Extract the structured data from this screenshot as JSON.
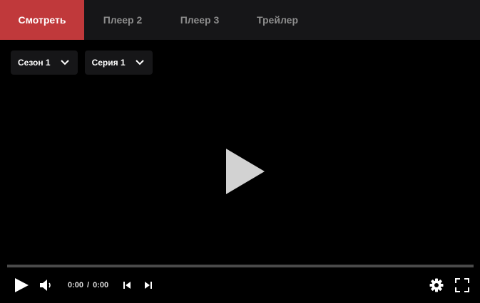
{
  "tabs": [
    {
      "label": "Смотреть",
      "active": true
    },
    {
      "label": "Плеер 2",
      "active": false
    },
    {
      "label": "Плеер 3",
      "active": false
    },
    {
      "label": "Трейлер",
      "active": false
    }
  ],
  "selectors": {
    "season": "Сезон 1",
    "episode": "Серия 1"
  },
  "player": {
    "current_time": "0:00",
    "separator": "/",
    "duration": "0:00",
    "progress": 0
  },
  "colors": {
    "accent": "#c0393b",
    "tab_bar": "#161618",
    "tab_text": "#8d8d8d",
    "background": "#000000",
    "progress_track": "#4a4a4a"
  },
  "icons": [
    "play-icon",
    "volume-icon",
    "skip-previous-icon",
    "skip-next-icon",
    "gear-icon",
    "fullscreen-icon",
    "chevron-down-icon"
  ]
}
